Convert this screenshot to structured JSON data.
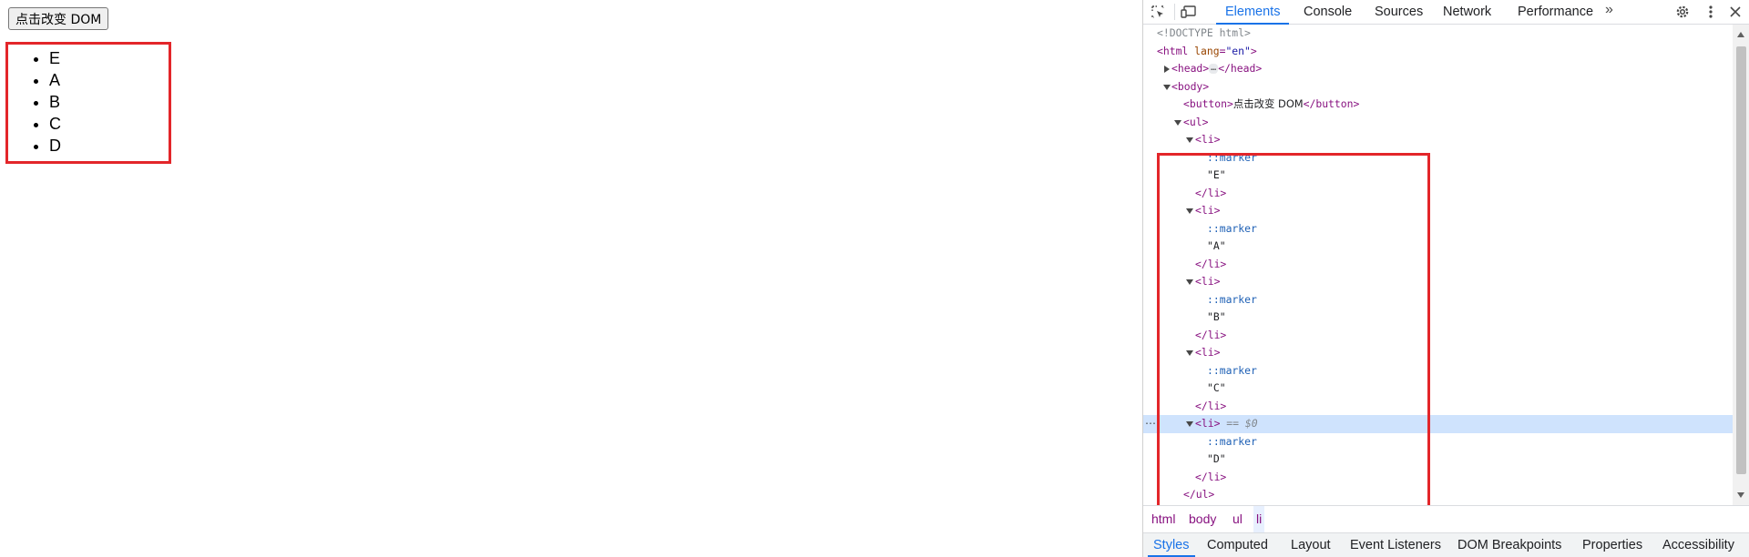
{
  "page": {
    "button_label": "点击改变 DOM",
    "list_items": [
      "E",
      "A",
      "B",
      "C",
      "D"
    ]
  },
  "devtools": {
    "tabs": [
      "Elements",
      "Console",
      "Sources",
      "Network",
      "Performance"
    ],
    "active_tab": "Elements",
    "more_tabs_glyph": "»",
    "dom": {
      "doctype": "<!DOCTYPE html>",
      "html_open_tag": "<html",
      "html_attr_name": "lang",
      "html_attr_value": "\"en\"",
      "html_open_close": ">",
      "head_open": "<head>",
      "head_ellipsis": "…",
      "head_close": "</head>",
      "body_open": "<body>",
      "button_open": "<button>",
      "button_text": "点击改变 DOM",
      "button_close": "</button>",
      "ul_open": "<ul>",
      "li_open": "<li>",
      "li_close": "</li>",
      "marker": "::marker",
      "li_texts": [
        "\"E\"",
        "\"A\"",
        "\"B\"",
        "\"C\"",
        "\"D\""
      ],
      "selected_ref": "== $0",
      "ul_close": "</ul>"
    },
    "breadcrumbs": [
      "html",
      "body",
      "ul",
      "li"
    ],
    "active_breadcrumb": "li",
    "bottom_tabs": [
      "Styles",
      "Computed",
      "Layout",
      "Event Listeners",
      "DOM Breakpoints",
      "Properties",
      "Accessibility"
    ],
    "active_bottom_tab": "Styles"
  },
  "colors": {
    "annotation_red": "#e3262a",
    "accent_blue": "#1a73e8",
    "selected_row": "#cfe3fd",
    "tag_purple": "#881280"
  },
  "icons": {
    "inspect": "inspect-element-icon",
    "device": "device-toolbar-icon",
    "settings": "gear-icon",
    "menu": "kebab-menu-icon",
    "close": "close-icon"
  }
}
